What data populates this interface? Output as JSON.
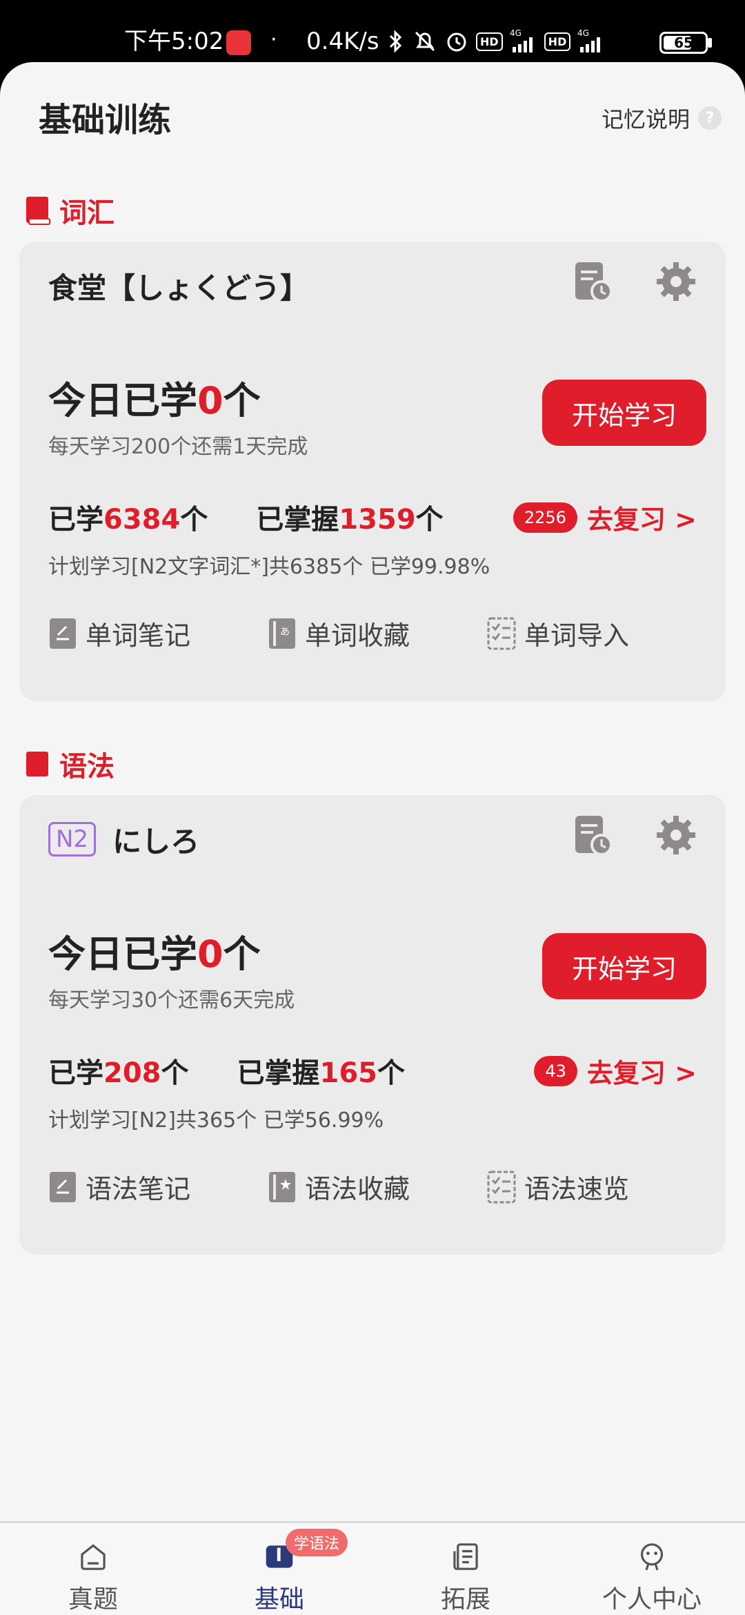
{
  "status_bar": {
    "time": "下午5:02",
    "dot": "·",
    "speed": "0.4K/s",
    "hd1": "HD",
    "hd2": "HD",
    "battery": "65",
    "network": "4G"
  },
  "header": {
    "title": "基础训练",
    "memory_help": "记忆说明",
    "help_glyph": "?"
  },
  "vocab": {
    "section_title": "词汇",
    "word": "食堂【しょくどう】",
    "today_prefix": "今日已学",
    "today_count": "0",
    "today_suffix": "个",
    "daily_plan": "每天学习200个还需1天完成",
    "start_button": "开始学习",
    "learned_prefix": "已学",
    "learned_count": "6384",
    "learned_suffix": "个",
    "mastered_prefix": "已掌握",
    "mastered_count": "1359",
    "mastered_suffix": "个",
    "review_count": "2256",
    "review_label": "去复习 >",
    "plan_summary": "计划学习[N2文字词汇*]共6385个 已学99.98%",
    "tools": [
      "单词笔记",
      "单词收藏",
      "单词导入"
    ]
  },
  "grammar": {
    "section_title": "语法",
    "level": "N2",
    "word": "にしろ",
    "today_prefix": "今日已学",
    "today_count": "0",
    "today_suffix": "个",
    "daily_plan": "每天学习30个还需6天完成",
    "start_button": "开始学习",
    "learned_prefix": "已学",
    "learned_count": "208",
    "learned_suffix": "个",
    "mastered_prefix": "已掌握",
    "mastered_count": "165",
    "mastered_suffix": "个",
    "review_count": "43",
    "review_label": "去复习 >",
    "plan_summary": "计划学习[N2]共365个 已学56.99%",
    "tools": [
      "语法笔记",
      "语法收藏",
      "语法速览"
    ]
  },
  "bottom_nav": {
    "items": [
      {
        "label": "真题",
        "icon": "home-icon"
      },
      {
        "label": "基础",
        "icon": "book-icon",
        "badge": "学语法",
        "active": true
      },
      {
        "label": "拓展",
        "icon": "document-icon"
      },
      {
        "label": "个人中心",
        "icon": "profile-icon"
      }
    ]
  },
  "colors": {
    "accent": "#e01e2b",
    "background": "#f5f5f5",
    "card": "#ebebeb",
    "nav_active": "#2a3a7a",
    "level_badge": "#a070d8"
  }
}
